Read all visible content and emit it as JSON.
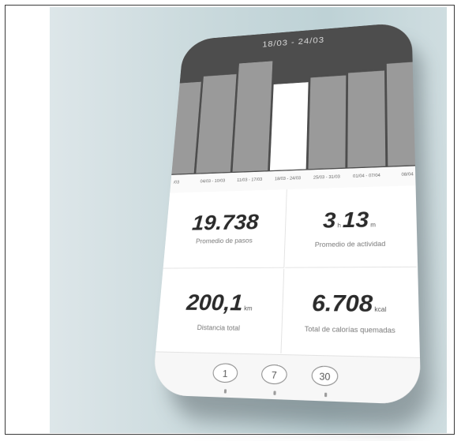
{
  "header": {
    "date_range": "18/03 - 24/03"
  },
  "chart_data": {
    "type": "bar",
    "categories": [
      "/03",
      "04/03 - 10/03",
      "11/03 - 17/03",
      "18/03 - 24/03",
      "25/03 - 31/03",
      "01/04 - 07/04",
      "08/04"
    ],
    "values": [
      0.85,
      0.9,
      1.0,
      0.78,
      0.82,
      0.84,
      0.9
    ],
    "selected_index": 3,
    "title": "",
    "xlabel": "",
    "ylabel": "",
    "colors": {
      "bar": "#9a9a9a",
      "selected": "#ffffff",
      "background": "#4d4d4d"
    }
  },
  "stats": {
    "steps": {
      "value": "19.738",
      "caption": "Promedio de pasos"
    },
    "activity": {
      "hours": "3",
      "hours_unit": "h",
      "minutes": "13",
      "minutes_unit": "m",
      "caption": "Promedio de actividad"
    },
    "distance": {
      "value": "200,1",
      "unit": "km",
      "caption": "Distancia total"
    },
    "calories": {
      "value": "6.708",
      "unit": "kcal",
      "caption": "Total de calorías quemadas"
    }
  },
  "range_buttons": [
    {
      "label": "1"
    },
    {
      "label": "7"
    },
    {
      "label": "30"
    }
  ]
}
